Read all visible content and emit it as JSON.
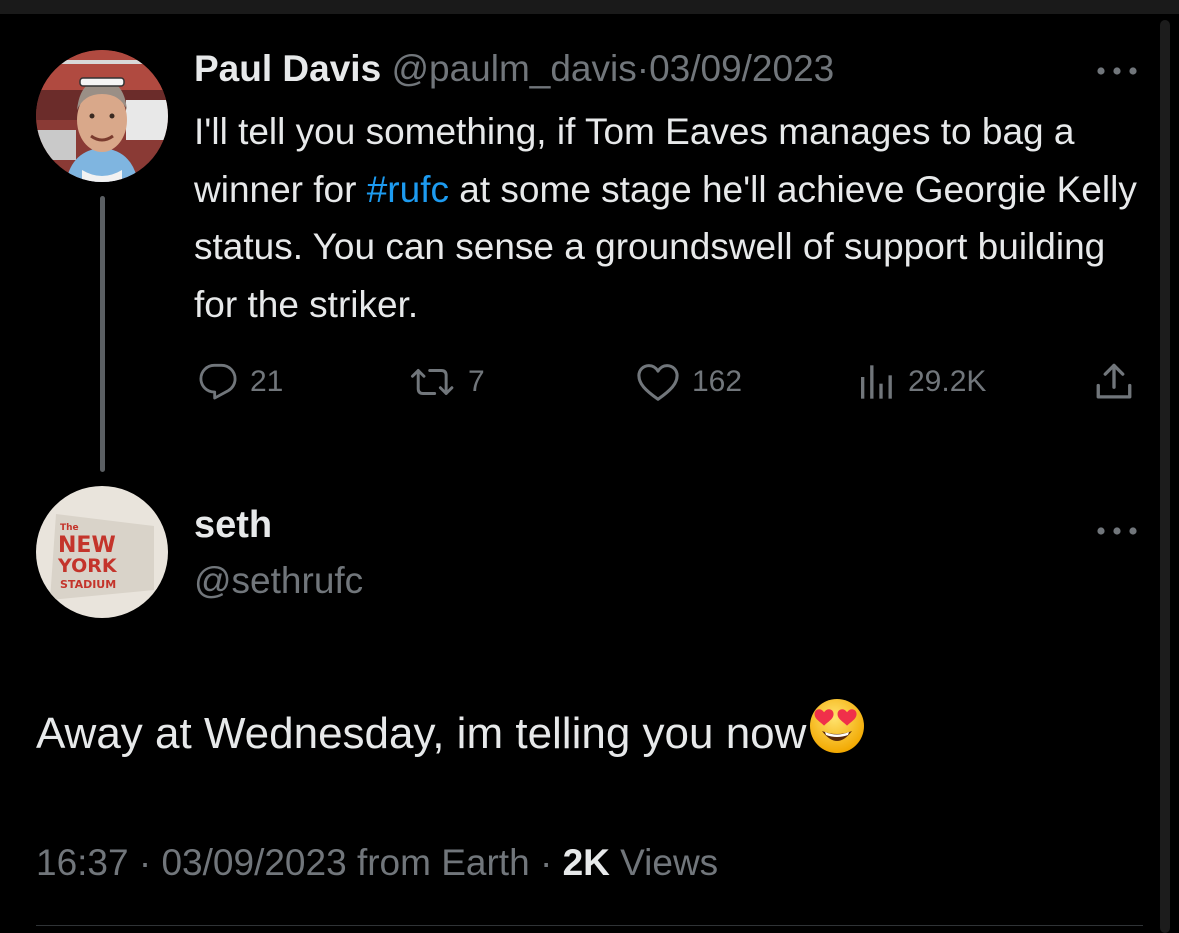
{
  "parent_tweet": {
    "display_name": "Paul Davis",
    "handle": "@paulm_davis",
    "separator": "·",
    "date": "03/09/2023",
    "more": "···",
    "text_before": "I'll tell you something, if Tom Eaves manages to bag a winner for ",
    "hashtag": "#rufc",
    "text_after": " at some stage he'll achieve Georgie Kelly status. You can sense a groundswell of support building for the striker.",
    "stats": {
      "replies": "21",
      "retweets": "7",
      "likes": "162",
      "views": "29.2K"
    }
  },
  "reply_tweet": {
    "display_name": "seth",
    "handle": "@sethrufc",
    "more": "···",
    "text": "Away at Wednesday, im telling you now",
    "emoji_name": "smiling-face-with-heart-eyes",
    "avatar_sign": [
      "The",
      "NEW",
      "YORK",
      "STADIUM"
    ],
    "time": "16:37",
    "separator": "·",
    "date": "03/09/2023",
    "source": "from Earth",
    "separator2": "·",
    "views_count": "2K",
    "views_label": "Views"
  },
  "colors": {
    "background": "#000000",
    "text": "#e7e9ea",
    "muted": "#71767b",
    "link": "#1d9bf0"
  },
  "icons": [
    "reply-icon",
    "retweet-icon",
    "like-icon",
    "views-icon",
    "share-icon",
    "more-icon"
  ]
}
